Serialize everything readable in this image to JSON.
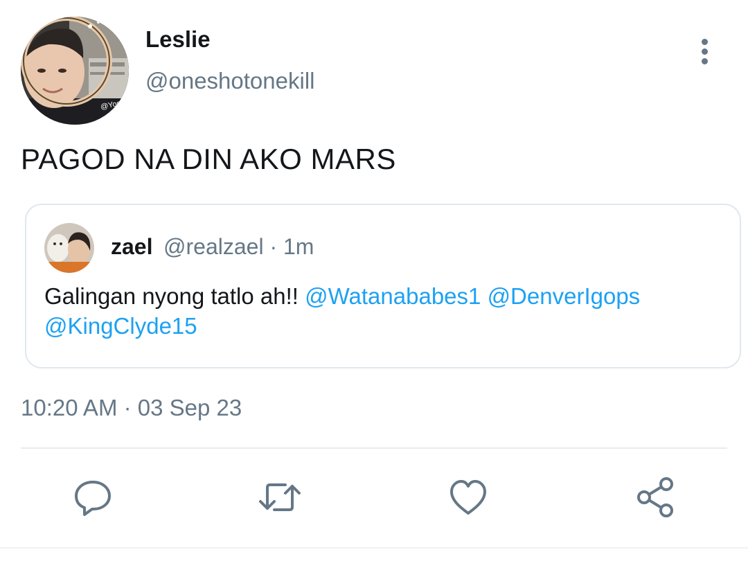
{
  "author": {
    "display_name": "Leslie",
    "handle": "@oneshotonekill",
    "avatar_watermark": "@Yoondan"
  },
  "tweet": {
    "text": "PAGOD NA DIN AKO MARS",
    "timestamp": "10:20 AM · 03 Sep 23"
  },
  "quoted_tweet": {
    "name": "zael",
    "meta": "@realzael · 1m",
    "text_plain": "Galingan nyong tatlo ah!! ",
    "mentions": [
      "@Watanababes1",
      "@DenverIgops",
      "@KingClyde15"
    ]
  },
  "actions": [
    {
      "icon": "reply-icon"
    },
    {
      "icon": "retweet-icon"
    },
    {
      "icon": "like-icon"
    },
    {
      "icon": "share-icon"
    }
  ],
  "colors": {
    "text": "#14171a",
    "secondary": "#657786",
    "mention": "#1da1f2",
    "border": "#e1e8ed"
  }
}
